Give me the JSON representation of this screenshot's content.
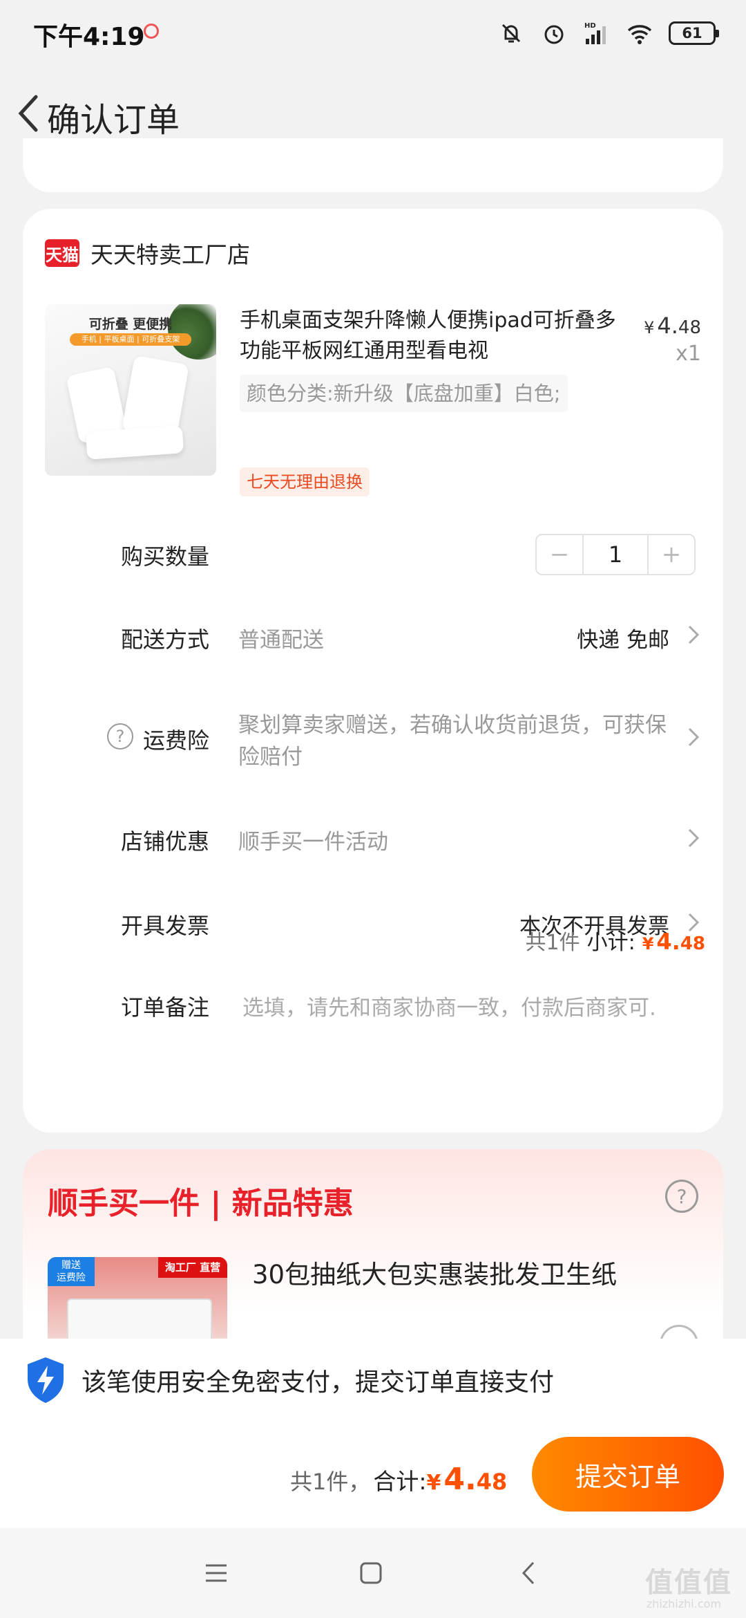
{
  "status_bar": {
    "time": "下午4:19",
    "battery": "61"
  },
  "header": {
    "title": "确认订单"
  },
  "shop": {
    "logo_text": "天猫",
    "name": "天天特卖工厂店"
  },
  "product": {
    "image_title": "可折叠 更便携",
    "image_subtitle": "手机 | 平板桌面 | 可折叠支架",
    "title": "手机桌面支架升降懒人便携ipad可折叠多功能平板网红通用型看电视",
    "price_currency": "¥",
    "price_int": "4.",
    "price_dec": "48",
    "quantity": "x1",
    "variant": "颜色分类:新升级【底盘加重】白色;",
    "return_badge": "七天无理由退换"
  },
  "order_rows": {
    "quantity_label": "购买数量",
    "quantity_value": "1",
    "quantity_minus": "−",
    "quantity_plus": "+",
    "delivery_label": "配送方式",
    "delivery_value": "普通配送",
    "delivery_right": "快递 免邮",
    "insurance_label": "运费险",
    "insurance_value": "聚划算卖家赠送，若确认收货前退货，可获保险赔付",
    "store_discount_label": "店铺优惠",
    "store_discount_value": "顺手买一件活动",
    "invoice_label": "开具发票",
    "invoice_right": "本次不开具发票",
    "note_label": "订单备注",
    "note_placeholder": "选填，请先和商家协商一致，付款后商家可."
  },
  "subtotal": {
    "count": "共1件",
    "label": "小计:",
    "currency": "¥",
    "int": "4.",
    "dec": "48"
  },
  "promo": {
    "title": "顺手买一件 | 新品特惠",
    "badge_left": "赠送\n运费险",
    "badge_right": "淘工厂 直营",
    "product_name": "30包抽纸大包实惠装批发卫生纸"
  },
  "bottom": {
    "secure_text": "该笔使用安全免密支付，提交订单直接支付",
    "total_count": "共1件，",
    "total_label": "合计:",
    "total_currency": "¥",
    "total_int": "4.",
    "total_dec": "48",
    "submit_label": "提交订单"
  },
  "watermark": {
    "text": "值值值",
    "sub": "zhizhizhi.com"
  },
  "colors": {
    "accent": "#ff5000",
    "tmall_red": "#e8202a",
    "background": "#f2f2f2"
  }
}
